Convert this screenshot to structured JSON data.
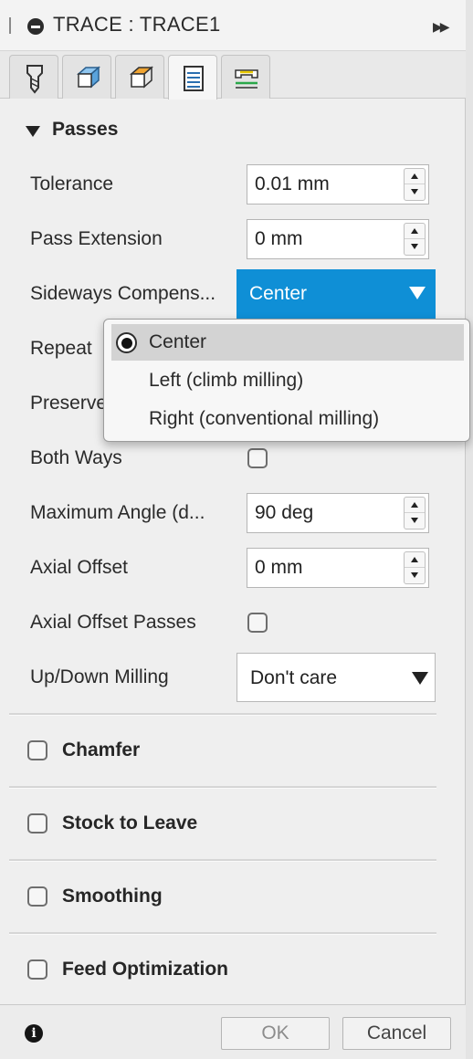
{
  "header": {
    "title": "TRACE : TRACE1"
  },
  "tabs": [
    {
      "name": "tool-tab"
    },
    {
      "name": "geometry-tab"
    },
    {
      "name": "heights-tab"
    },
    {
      "name": "passes-tab",
      "active": true
    },
    {
      "name": "linking-tab"
    }
  ],
  "passes": {
    "section_label": "Passes",
    "tolerance": {
      "label": "Tolerance",
      "value": "0.01 mm"
    },
    "pass_extension": {
      "label": "Pass Extension",
      "value": "0 mm"
    },
    "sideways_compensation": {
      "label": "Sideways Compens...",
      "value": "Center"
    },
    "repeat": {
      "label": "Repeat"
    },
    "preserve": {
      "label": "Preserve"
    },
    "both_ways": {
      "label": "Both Ways",
      "checked": false
    },
    "maximum_angle": {
      "label": "Maximum Angle (d...",
      "value": "90 deg"
    },
    "axial_offset": {
      "label": "Axial Offset",
      "value": "0 mm"
    },
    "axial_offset_passes": {
      "label": "Axial Offset Passes",
      "checked": false
    },
    "up_down_milling": {
      "label": "Up/Down Milling",
      "value": "Don't care"
    }
  },
  "sections": {
    "chamfer": "Chamfer",
    "stock_to_leave": "Stock to Leave",
    "smoothing": "Smoothing",
    "feed_optimization": "Feed Optimization"
  },
  "dropdown": {
    "options": [
      "Center",
      "Left (climb milling)",
      "Right (conventional milling)"
    ],
    "selected": "Center"
  },
  "footer": {
    "ok_label": "OK",
    "cancel_label": "Cancel"
  },
  "colors": {
    "accent": "#0f8fd6",
    "panel_bg": "#efefef"
  }
}
